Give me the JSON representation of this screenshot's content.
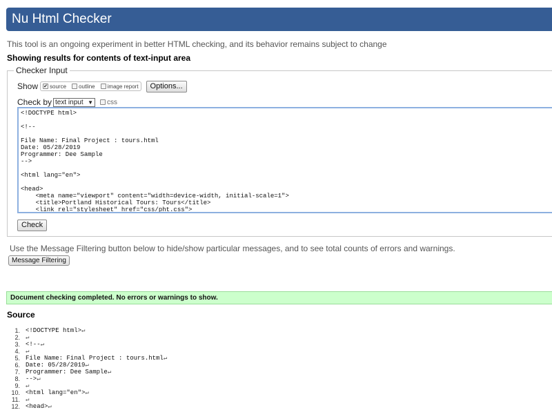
{
  "header": {
    "title": "Nu Html Checker"
  },
  "tagline": "This tool is an ongoing experiment in better HTML checking, and its behavior remains subject to change",
  "showing": "Showing results for contents of text-input area",
  "checker_input": {
    "legend": "Checker Input",
    "show_label": "Show",
    "show_options": [
      {
        "label": "source",
        "checked": "✔"
      },
      {
        "label": "outline",
        "checked": ""
      },
      {
        "label": "image report",
        "checked": ""
      }
    ],
    "options_button": "Options...",
    "check_by_label": "Check by",
    "check_by_value": "text input",
    "css_label": "css",
    "editor_lines": [
      "<!DOCTYPE html>",
      "",
      "<!--",
      "",
      "File Name: Final Project : tours.html",
      "Date: 05/28/2019",
      "Programmer: Dee Sample",
      "-->",
      "",
      "<html lang=\"en\">",
      "",
      "<head>",
      "    <meta name=\"viewport\" content=\"width=device-width, initial-scale=1\">",
      "    <title>Portland Historical Tours: Tours</title>",
      "    <link rel=\"stylesheet\" href=\"css/pht.css\">"
    ],
    "check_button": "Check"
  },
  "filter": {
    "text": "Use the Message Filtering button below to hide/show particular messages, and to see total counts of errors and warnings.",
    "button": "Message Filtering"
  },
  "status": {
    "message": "Document checking completed. No errors or warnings to show."
  },
  "source": {
    "title": "Source",
    "newline_glyph": "↵",
    "lines": [
      {
        "num": "1.",
        "code": "<!DOCTYPE html>"
      },
      {
        "num": "2.",
        "code": ""
      },
      {
        "num": "3.",
        "code": "<!--"
      },
      {
        "num": "4.",
        "code": ""
      },
      {
        "num": "5.",
        "code": "File Name: Final Project : tours.html"
      },
      {
        "num": "6.",
        "code": "Date: 05/28/2019"
      },
      {
        "num": "7.",
        "code": "Programmer: Dee Sample"
      },
      {
        "num": "8.",
        "code": "-->"
      },
      {
        "num": "9.",
        "code": ""
      },
      {
        "num": "10.",
        "code": "<html lang=\"en\">"
      },
      {
        "num": "11.",
        "code": ""
      },
      {
        "num": "12.",
        "code": "<head>"
      }
    ]
  }
}
